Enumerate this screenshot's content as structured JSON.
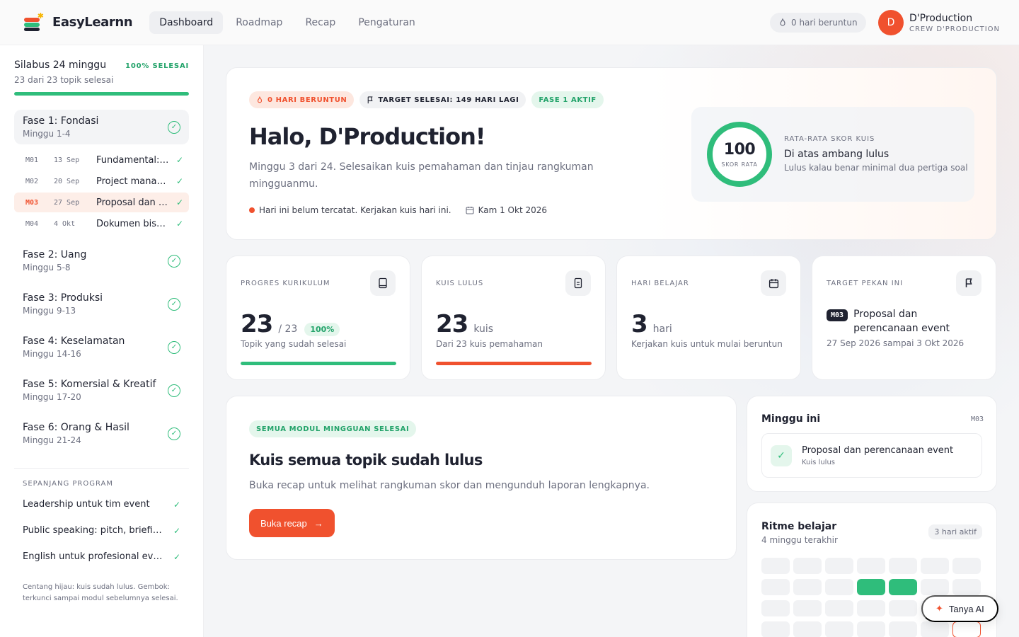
{
  "brand": {
    "name": "EasyLearnn"
  },
  "nav": [
    "Dashboard",
    "Roadmap",
    "Recap",
    "Pengaturan"
  ],
  "topbar": {
    "streak": "0 hari beruntun"
  },
  "user": {
    "initial": "D",
    "name": "D'Production",
    "role": "CREW D'PRODUCTION"
  },
  "sidebar": {
    "title": "Silabus 24 minggu",
    "done_label": "100% SELESAI",
    "subtitle": "23 dari 23 topik selesai",
    "progress": 1.0,
    "phases": [
      {
        "name": "Fase 1: Fondasi",
        "weeks": "Minggu 1-4"
      },
      {
        "name": "Fase 2: Uang",
        "weeks": "Minggu 5-8"
      },
      {
        "name": "Fase 3: Produksi",
        "weeks": "Minggu 9-13"
      },
      {
        "name": "Fase 4: Keselamatan",
        "weeks": "Minggu 14-16"
      },
      {
        "name": "Fase 5: Komersial & Kreatif",
        "weeks": "Minggu 17-20"
      },
      {
        "name": "Fase 6: Orang & Hasil",
        "weeks": "Minggu 21-24"
      }
    ],
    "modules": [
      {
        "code": "M01",
        "date": "13 Sep",
        "title": "Fundamental: ..."
      },
      {
        "code": "M02",
        "date": "20 Sep",
        "title": "Project manag..."
      },
      {
        "code": "M03",
        "date": "27 Sep",
        "title": "Proposal dan p..."
      },
      {
        "code": "M04",
        "date": "4 Okt",
        "title": "Dokumen bisni..."
      }
    ],
    "program_label": "SEPANJANG PROGRAM",
    "program_items": [
      "Leadership untuk tim event",
      "Public speaking: pitch, briefing,...",
      "English untuk profesional event"
    ],
    "note": "Centang hijau: kuis sudah lulus. Gembok: terkunci sampai modul sebelumnya selesai."
  },
  "hero": {
    "chip_streak": "0 HARI BERUNTUN",
    "chip_target": "TARGET SELESAI: 149 HARI LAGI",
    "chip_phase": "FASE 1 AKTIF",
    "title": "Halo, D'Production!",
    "desc": "Minggu 3 dari 24. Selesaikan kuis pemahaman dan tinjau rangkuman mingguanmu.",
    "status": "Hari ini belum tercatat. Kerjakan kuis hari ini.",
    "date": "Kam 1 Okt 2026",
    "score_value": "100",
    "score_label": "SKOR RATA",
    "score_caption": "RATA-RATA SKOR KUIS",
    "score_heading": "Di atas ambang lulus",
    "score_sub": "Lulus kalau benar minimal dua pertiga soal"
  },
  "stats": {
    "curriculum": {
      "caption": "PROGRES KURIKULUM",
      "value": "23",
      "unit": "/ 23",
      "pct": "100%",
      "sub": "Topik yang sudah selesai",
      "progress": 1.0,
      "color": "#2fbd7b"
    },
    "quiz": {
      "caption": "KUIS LULUS",
      "value": "23",
      "unit": "kuis",
      "sub": "Dari 23 kuis pemahaman",
      "progress": 1.0,
      "color": "#f0512e"
    },
    "days": {
      "caption": "HARI BELAJAR",
      "value": "3",
      "unit": "hari",
      "sub": "Kerjakan kuis untuk mulai beruntun"
    },
    "target": {
      "caption": "TARGET PEKAN INI",
      "code": "M03",
      "title": "Proposal dan perencanaan event",
      "date": "27 Sep 2026 sampai 3 Okt 2026"
    }
  },
  "done": {
    "chip": "SEMUA MODUL MINGGUAN SELESAI",
    "title": "Kuis semua topik sudah lulus",
    "desc": "Buka recap untuk melihat rangkuman skor dan mengunduh laporan lengkapnya.",
    "button": "Buka recap"
  },
  "week": {
    "title": "Minggu ini",
    "code": "M03",
    "item_title": "Proposal dan perencanaan event",
    "item_sub": "Kuis lulus"
  },
  "rhythm": {
    "title": "Ritme belajar",
    "sub": "4 minggu terakhir",
    "pill": "3 hari aktif",
    "cells": [
      0,
      0,
      0,
      0,
      0,
      0,
      0,
      0,
      0,
      0,
      1,
      1,
      0,
      0,
      0,
      0,
      0,
      0,
      0,
      0,
      0,
      0,
      0,
      0,
      0,
      0,
      0,
      2
    ]
  },
  "ai": {
    "label": "Tanya AI"
  }
}
